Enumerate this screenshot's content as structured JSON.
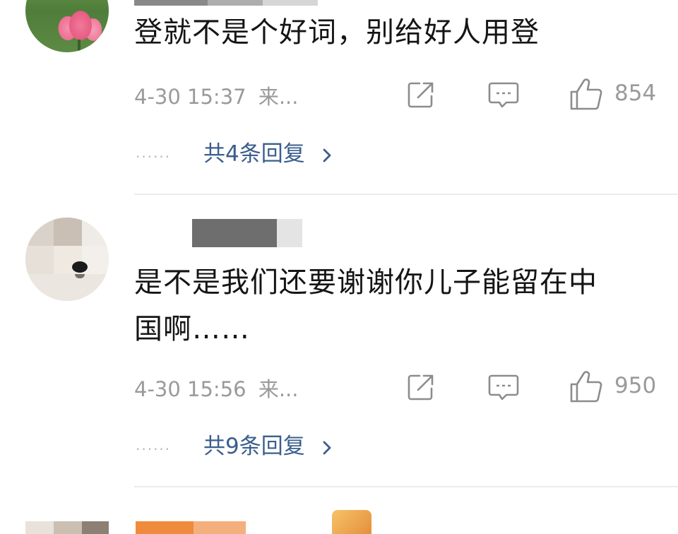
{
  "comments": [
    {
      "text_lines": [
        "登就不是个好词，别给好人用登"
      ],
      "timestamp": "4-30 15:37",
      "source": "来...",
      "likes": "854",
      "replies_label": "共4条回复",
      "reply_dots": "......"
    },
    {
      "text_lines": [
        "是不是我们还要谢谢你儿子能留在中",
        "国啊……"
      ],
      "timestamp": "4-30 15:56",
      "source": "来...",
      "likes": "950",
      "replies_label": "共9条回复",
      "reply_dots": "......"
    }
  ],
  "icons": {
    "share": "share-edit-icon",
    "comment": "comment-bubble-icon",
    "like": "thumbs-up-icon",
    "chevron": "chevron-right-icon"
  },
  "colors": {
    "reply_link": "#3b5e8c",
    "meta_gray": "#9a9a9a"
  }
}
